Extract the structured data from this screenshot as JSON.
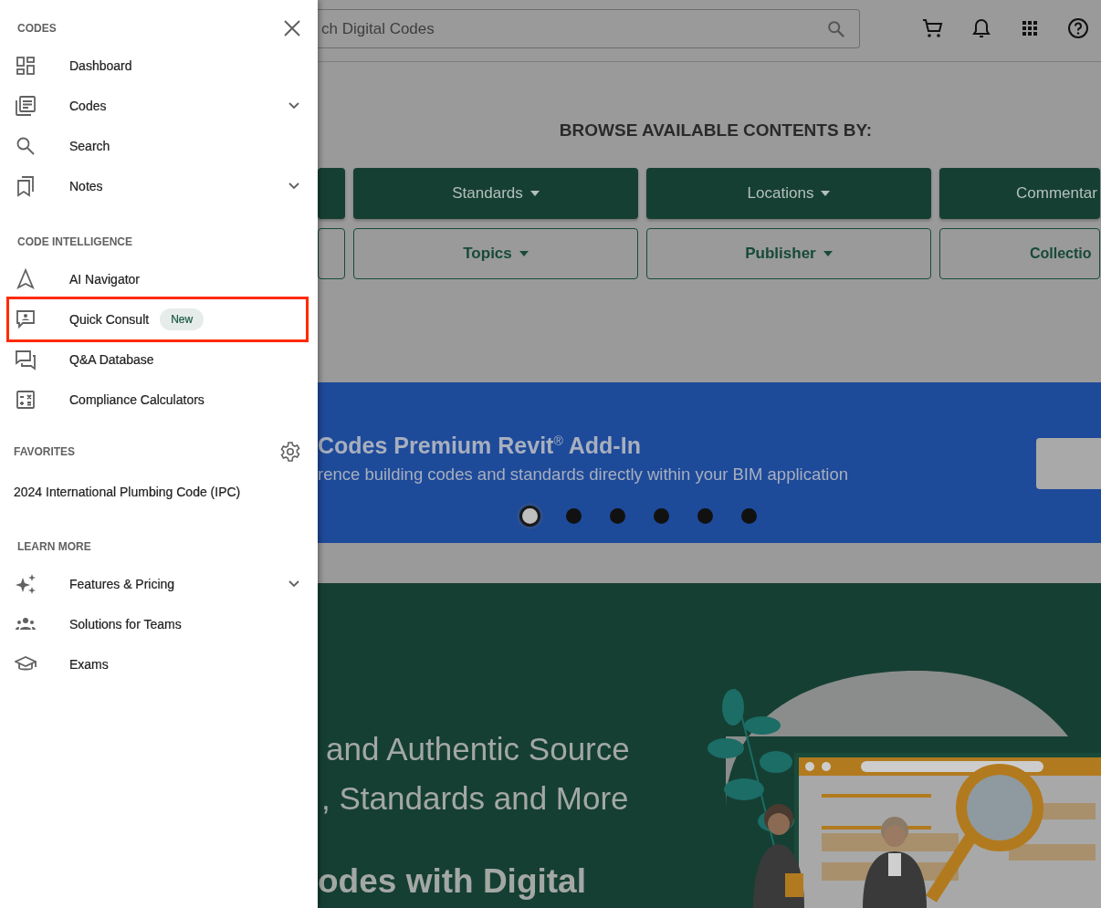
{
  "drawer": {
    "sections": [
      {
        "heading": "CODES",
        "kind": "closable",
        "items": [
          {
            "label": "Dashboard",
            "kind": "link",
            "highlighted": false
          },
          {
            "label": "Codes",
            "kind": "expandable",
            "expanded": false,
            "highlighted": false
          },
          {
            "label": "Search",
            "kind": "link",
            "highlighted": false
          },
          {
            "label": "Notes",
            "kind": "expandable",
            "expanded": false,
            "highlighted": false
          }
        ]
      },
      {
        "heading": "CODE INTELLIGENCE",
        "items": [
          {
            "label": "AI Navigator",
            "kind": "link",
            "highlighted": false
          },
          {
            "label": "Quick Consult",
            "kind": "link",
            "badge": "New",
            "highlighted": true
          },
          {
            "label": "Q&A Database",
            "kind": "link",
            "highlighted": false
          },
          {
            "label": "Compliance Calculators",
            "kind": "link",
            "highlighted": false
          }
        ]
      },
      {
        "heading": "FAVORITES",
        "kind": "configurable",
        "items": [
          {
            "label": "2024 International Plumbing Code (IPC)",
            "kind": "favorite",
            "highlighted": false
          }
        ]
      },
      {
        "heading": "LEARN MORE",
        "items": [
          {
            "label": "Features & Pricing",
            "kind": "expandable",
            "expanded": false,
            "highlighted": false
          },
          {
            "label": "Solutions for Teams",
            "kind": "link",
            "highlighted": false
          },
          {
            "label": "Exams",
            "kind": "link",
            "highlighted": false
          }
        ]
      }
    ]
  },
  "header": {
    "search": {
      "placeholder": "ch Digital Codes"
    }
  },
  "browse": {
    "heading": "BROWSE AVAILABLE CONTENTS BY:",
    "rows": [
      [
        {
          "kind": "filled"
        },
        {
          "kind": "filled",
          "label": "Standards"
        },
        {
          "kind": "filled",
          "label": "Locations"
        },
        {
          "kind": "filled",
          "label": "Commentar"
        }
      ],
      [
        {
          "kind": "outlined"
        },
        {
          "kind": "outlined",
          "label": "Topics"
        },
        {
          "kind": "outlined",
          "label": "Publisher"
        },
        {
          "kind": "outlined",
          "label": "Collectio"
        }
      ]
    ]
  },
  "banner": {
    "title": "Codes Premium Revit$^{®}$ Add-In",
    "subtitle": "rence building codes and standards directly within your BIM application",
    "dots": [
      {
        "selected": true
      },
      {
        "selected": false
      },
      {
        "selected": false
      },
      {
        "selected": false
      },
      {
        "selected": false
      },
      {
        "selected": false
      }
    ]
  },
  "hero": {
    "lines": [
      "and Authentic Source",
      ", Standards and More"
    ],
    "subheading": "odes with Digital"
  }
}
